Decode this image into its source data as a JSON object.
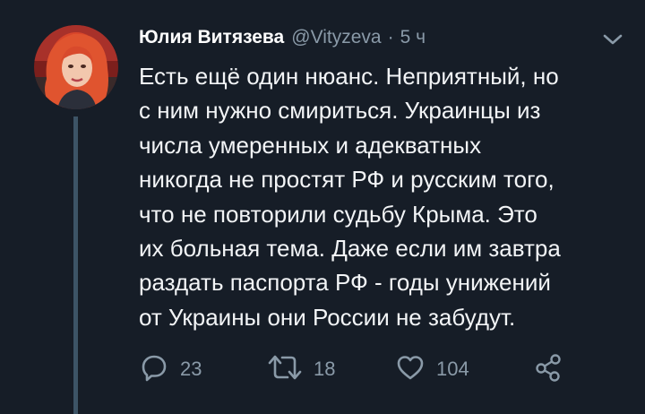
{
  "author": {
    "name": "Юлия Витязева",
    "handle": "@Vityzeva",
    "separator": "·",
    "time": "5 ч"
  },
  "tweet": {
    "text": "Есть ещё один нюанс. Неприятный, но\nс ним нужно смириться. Украинцы из\nчисла умеренных и адекватных\nникогда не простят РФ и русским того,\nчто не повторили судьбу Крыма. Это\nих больная тема. Даже если им завтра\nраздать паспорта РФ - годы унижений\nот Украины они России не забудут."
  },
  "actions": {
    "reply_count": "23",
    "retweet_count": "18",
    "like_count": "104"
  },
  "icons": {
    "reply": "reply-icon",
    "retweet": "retweet-icon",
    "like": "heart-icon",
    "share": "share-icon",
    "menu": "chevron-down-icon"
  },
  "colors": {
    "background": "#161d27",
    "text": "#f2f4f6",
    "secondary": "#8a9aa8",
    "thread_line": "#3d5466"
  }
}
